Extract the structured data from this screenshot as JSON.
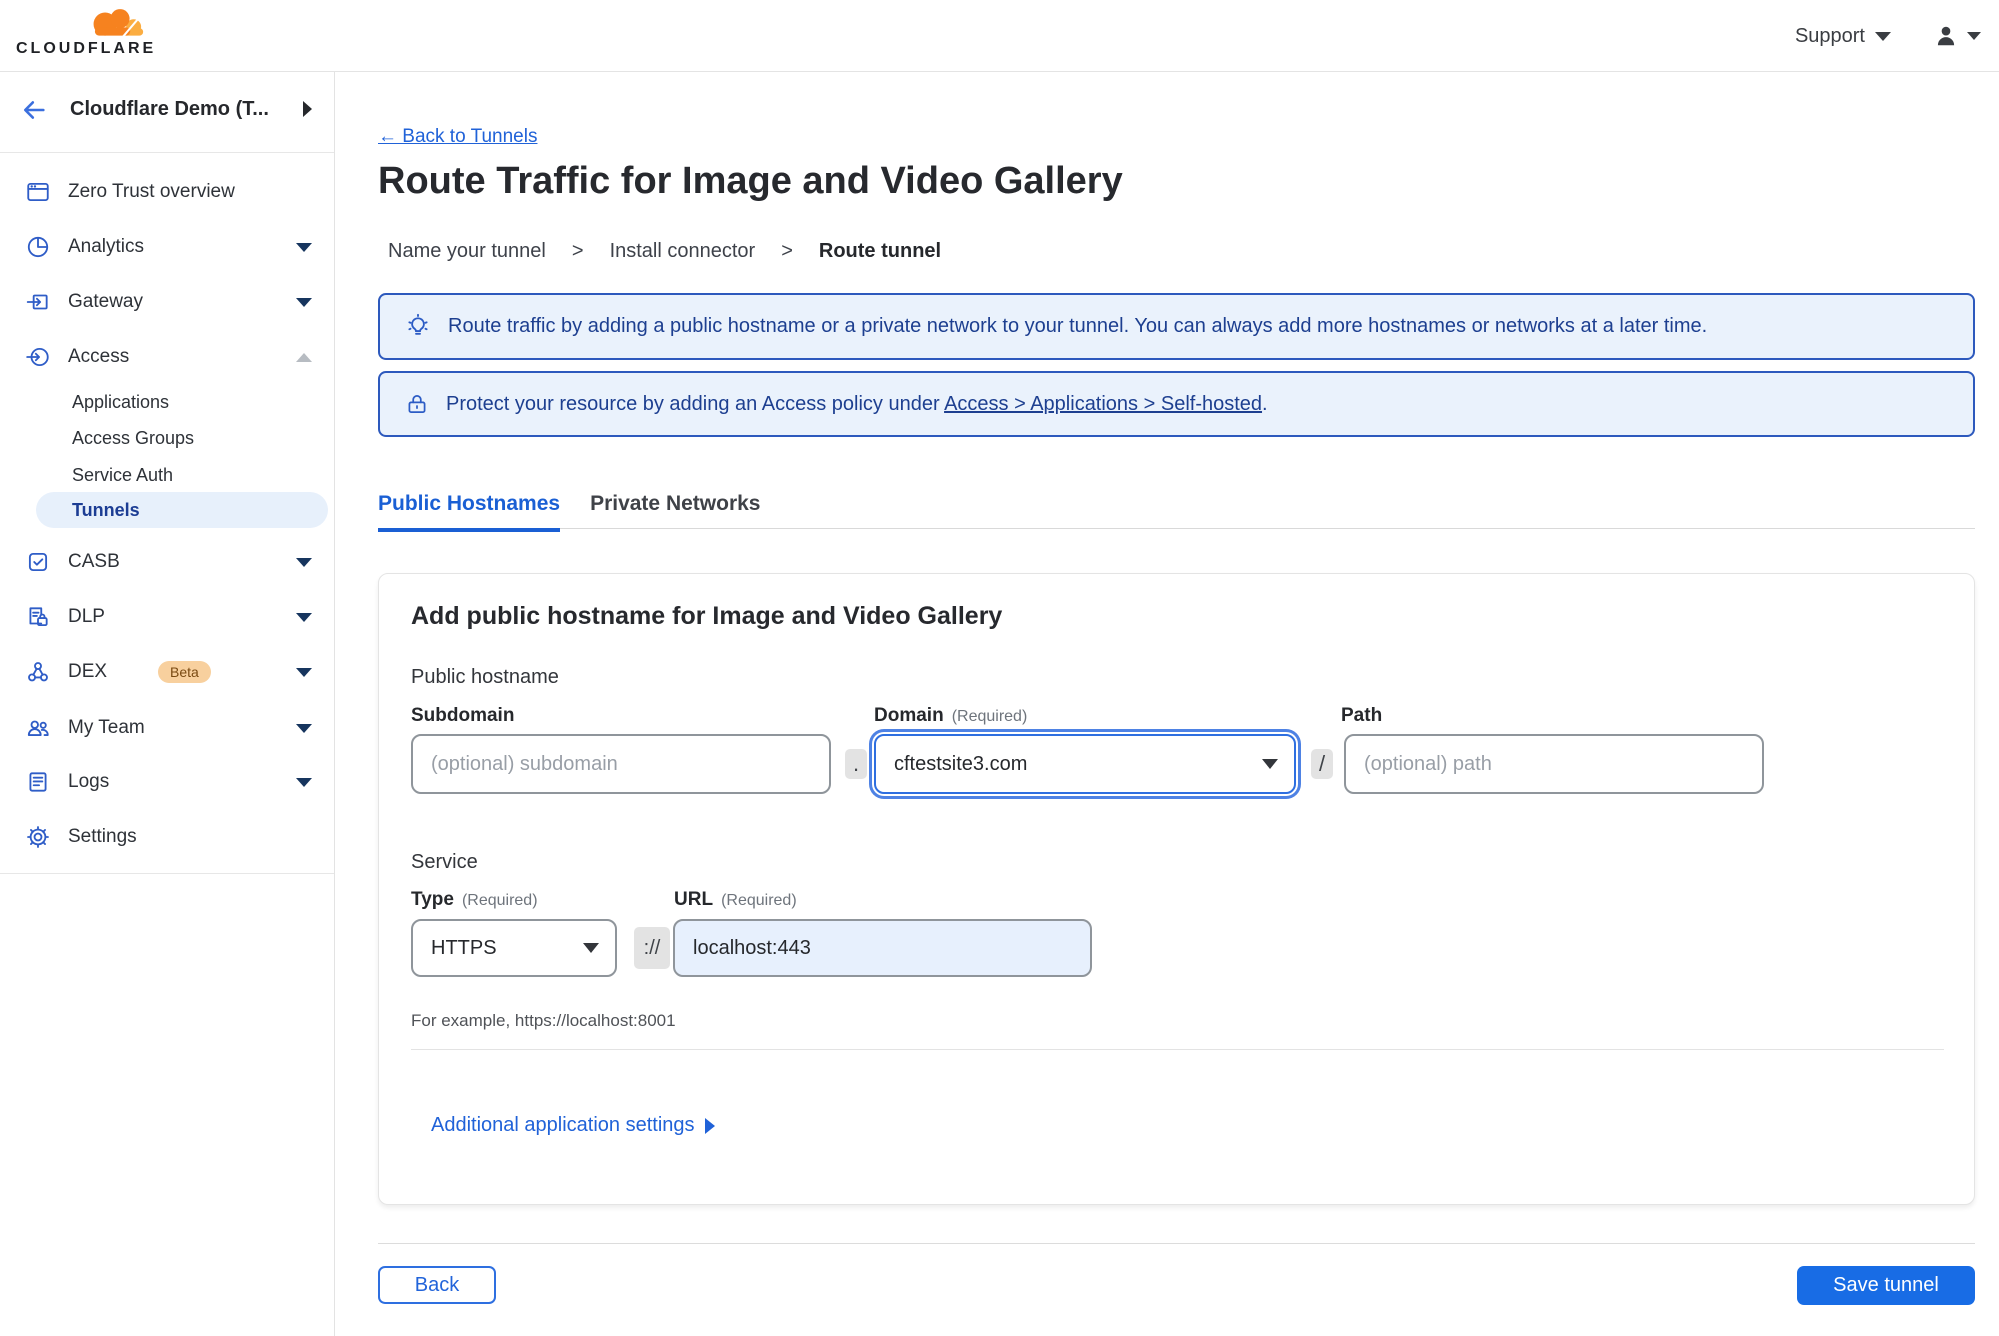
{
  "brand": {
    "name": "CLOUDFLARE"
  },
  "topbar": {
    "support_label": "Support"
  },
  "sidebar": {
    "account_name": "Cloudflare Demo (T...",
    "items": [
      {
        "label": "Zero Trust overview"
      },
      {
        "label": "Analytics"
      },
      {
        "label": "Gateway"
      },
      {
        "label": "Access"
      },
      {
        "label": "Applications"
      },
      {
        "label": "Access Groups"
      },
      {
        "label": "Service Auth"
      },
      {
        "label": "Tunnels"
      },
      {
        "label": "CASB"
      },
      {
        "label": "DLP"
      },
      {
        "label": "DEX",
        "badge": "Beta"
      },
      {
        "label": "My Team"
      },
      {
        "label": "Logs"
      },
      {
        "label": "Settings"
      }
    ]
  },
  "page": {
    "back_link": "← Back to Tunnels",
    "title": "Route Traffic for Image and Video Gallery",
    "breadcrumb": {
      "step1": "Name your tunnel",
      "step2": "Install connector",
      "step3": "Route tunnel",
      "separator": ">"
    },
    "banner_tip": "Route traffic by adding a public hostname or a private network to your tunnel. You can always add more hostnames or networks at a later time.",
    "banner_lock": {
      "prefix": "Protect your resource by adding an Access policy under ",
      "link": "Access > Applications > Self-hosted",
      "suffix": "."
    },
    "tabs": {
      "public": "Public Hostnames",
      "private": "Private Networks"
    }
  },
  "form": {
    "card_title": "Add public hostname for Image and Video Gallery",
    "group_label": "Public hostname",
    "subdomain": {
      "label": "Subdomain",
      "placeholder": "(optional) subdomain"
    },
    "domain": {
      "label": "Domain",
      "required": "(Required)",
      "value": "cftestsite3.com"
    },
    "path": {
      "label": "Path",
      "placeholder": "(optional) path"
    },
    "sep_dot": ".",
    "sep_slash": "/",
    "sep_scheme": "://",
    "service_label": "Service",
    "type": {
      "label": "Type",
      "required": "(Required)",
      "value": "HTTPS"
    },
    "url": {
      "label": "URL",
      "required": "(Required)",
      "value": "localhost:443"
    },
    "example": "For example, https://localhost:8001",
    "additional_settings": "Additional application settings"
  },
  "footer": {
    "back": "Back",
    "save": "Save tunnel"
  },
  "colors": {
    "accent_blue": "#1a5fd4",
    "button_blue": "#186ce5",
    "banner_border": "#2d59bd",
    "banner_bg": "#eaf2fc",
    "banner_text": "#1d3f90",
    "active_nav_bg": "#e7f0fb",
    "active_nav_text": "#1c3d94",
    "brand_orange": "#f6821f",
    "brand_orange_light": "#fbad41",
    "beta_badge_bg": "#f8d09e"
  }
}
